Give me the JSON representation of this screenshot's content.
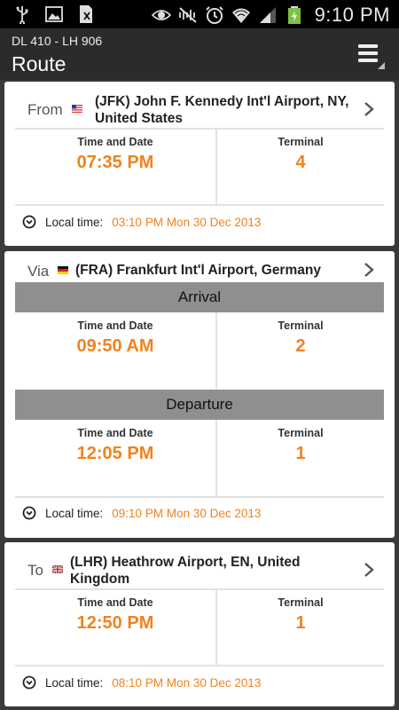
{
  "status_bar": {
    "time": "9:10 PM",
    "icons": [
      "usb-icon",
      "image-icon",
      "sim-icon",
      "eye-icon",
      "mute-icon",
      "alarm-icon",
      "wifi-icon",
      "signal-icon",
      "battery-icon"
    ]
  },
  "app_bar": {
    "flight_numbers": "DL 410 - LH 906",
    "title": "Route"
  },
  "labels": {
    "time_and_date": "Time and Date",
    "terminal": "Terminal",
    "local_time": "Local time:",
    "arrival": "Arrival",
    "departure": "Departure"
  },
  "from": {
    "prefix": "From",
    "airport_line1": "(JFK) John F. Kennedy Int'l Airport, NY,",
    "airport_line2": "United States",
    "time": "07:35 PM",
    "terminal": "4",
    "local_time": "03:10 PM Mon 30 Dec 2013"
  },
  "via": {
    "prefix": "Via",
    "airport": "(FRA) Frankfurt Int'l Airport, Germany",
    "arrival_time": "09:50 AM",
    "arrival_terminal": "2",
    "departure_time": "12:05 PM",
    "departure_terminal": "1",
    "local_time": "09:10 PM Mon 30 Dec 2013"
  },
  "to": {
    "prefix": "To",
    "airport_line1": "(LHR) Heathrow Airport, EN, United",
    "airport_line2": "Kingdom",
    "time": "12:50 PM",
    "terminal": "1",
    "local_time": "08:10 PM Mon 30 Dec 2013"
  },
  "colors": {
    "accent": "#f0831e",
    "band": "#8f8f8f",
    "app_bar": "#2b2b2b"
  }
}
